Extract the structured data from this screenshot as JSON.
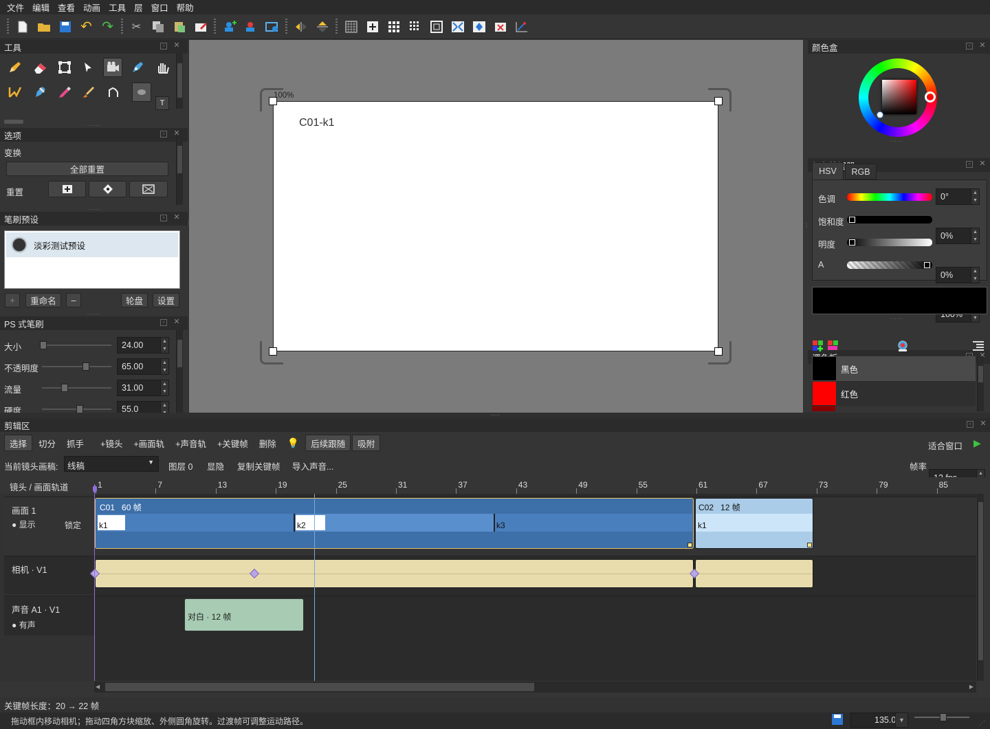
{
  "menu": [
    "文件",
    "编辑",
    "查看",
    "动画",
    "工具",
    "层",
    "窗口",
    "帮助"
  ],
  "toolbar_icons": [
    "new-file",
    "open-folder",
    "save",
    "undo",
    "redo",
    "cut",
    "copy",
    "paste",
    "clear",
    "add-camera",
    "remove-camera",
    "camera-fit",
    "flip-horizontal",
    "flip-vertical",
    "grid-fine",
    "grid-add",
    "grid-3x3",
    "grid-4x4",
    "safe-area",
    "fit-frame",
    "center-frame",
    "camera-reset",
    "camera-path"
  ],
  "tools_panel": {
    "title": "工具",
    "text_tool": "T"
  },
  "options_panel": {
    "title": "选项",
    "section": "变换",
    "reset_all": "全部重置",
    "reset_label": "重置"
  },
  "brush_preset_panel": {
    "title": "笔刷预设",
    "preset_name": "淡彩测试预设",
    "add": "+",
    "rename": "重命名",
    "remove": "–",
    "wheel": "轮盘",
    "settings": "设置"
  },
  "ps_brush_panel": {
    "title": "PS 式笔刷",
    "params": [
      {
        "label": "大小",
        "value": "24.00",
        "level": 0.02
      },
      {
        "label": "不透明度",
        "value": "65.00",
        "level": 0.63
      },
      {
        "label": "流量",
        "value": "31.00",
        "level": 0.33
      },
      {
        "label": "硬度",
        "value": "55.0",
        "level": 0.54
      }
    ]
  },
  "canvas": {
    "zoom_label": "100%",
    "frame_label": "C01-k1"
  },
  "color_box": {
    "title": "颜色盒"
  },
  "color_viewer": {
    "title": "颜色检视器",
    "tabs": [
      "HSV",
      "RGB"
    ],
    "active_tab": "HSV",
    "rows": [
      {
        "label": "色调",
        "value": "0°"
      },
      {
        "label": "饱和度",
        "value": "0%"
      },
      {
        "label": "明度",
        "value": "0%"
      },
      {
        "label": "A",
        "value": "100%"
      }
    ],
    "current_color": "#000000"
  },
  "palette": {
    "title": "调色板",
    "items": [
      {
        "name": "黑色",
        "color": "#000000"
      },
      {
        "name": "红色",
        "color": "#ff0000"
      }
    ]
  },
  "timeline": {
    "title": "剪辑区",
    "buttons": [
      "选择",
      "切分",
      "抓手",
      "+镜头",
      "+画面轨",
      "+声音轨",
      "+关键帧",
      "删除"
    ],
    "toggle_follow": "后续跟随",
    "toggle_snap": "吸附",
    "fit_window": "适合窗口",
    "current_shot_label": "当前镜头画稿:",
    "current_shot_value": "线稿",
    "layer_label": "图层 0",
    "show_label": "显隐",
    "copy_kf": "复制关键帧",
    "import_audio": "导入声音...",
    "fps_label": "帧率",
    "fps_value": "12 fps",
    "track_header": "镜头 / 画面轨道",
    "ruler": [
      "1",
      "7",
      "13",
      "19",
      "25",
      "31",
      "37",
      "43",
      "49",
      "55",
      "61",
      "67",
      "73",
      "79",
      "85"
    ],
    "track_picture": {
      "name": "画面 1",
      "show": "● 显示",
      "lock": "锁定"
    },
    "track_camera": {
      "name": "相机 · V1"
    },
    "track_audio": {
      "name": "声音 A1 · V1",
      "state": "● 有声"
    },
    "clips": [
      {
        "label": "C01",
        "frames": "60 帧",
        "keys": [
          "k1",
          "k2",
          "k3"
        ]
      },
      {
        "label": "C02",
        "frames": "12 帧",
        "keys": [
          "k1"
        ]
      }
    ],
    "audio_clip": "对白 · 12 帧"
  },
  "status": {
    "kf_length": "关键帧长度：20 → 22 帧",
    "hint": "拖动框内移动相机；拖动四角方块缩放、外侧圆角旋转。过渡帧可调整运动路径。",
    "zoom": "135.0%"
  }
}
